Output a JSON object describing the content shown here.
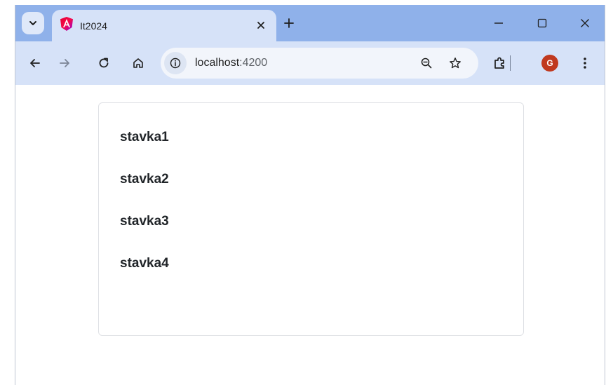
{
  "browser": {
    "tab": {
      "title": "It2024",
      "favicon": "angular-icon"
    },
    "address_bar": {
      "host": "localhost",
      "port": ":4200"
    },
    "profile": {
      "initial": "G",
      "color": "#c0391f"
    },
    "colors": {
      "titlebar": "#8fb1ea",
      "toolbar": "#d6e2f8"
    }
  },
  "page": {
    "items": [
      "stavka1",
      "stavka2",
      "stavka3",
      "stavka4"
    ]
  }
}
